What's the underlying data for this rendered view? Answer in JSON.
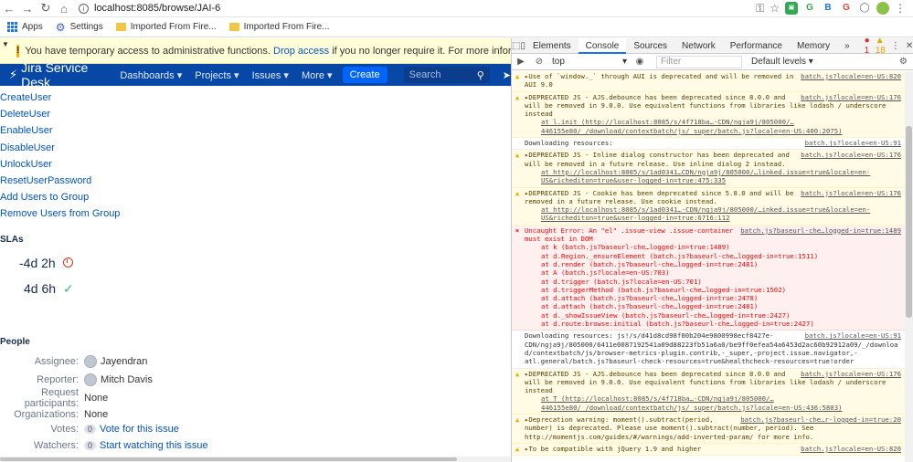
{
  "browser": {
    "url": "localhost:8085/browse/JAI-6",
    "bookmarks": [
      {
        "label": "Apps"
      },
      {
        "label": "Settings"
      },
      {
        "label": "Imported From Fire..."
      },
      {
        "label": "Imported From Fire..."
      }
    ],
    "extensions": [
      "G",
      "B",
      "G"
    ]
  },
  "banner": {
    "text_before": "You have temporary access to administrative functions.",
    "link": "Drop access",
    "text_after": "if you no longer require it. For more information, refer to the docs"
  },
  "jira_nav": {
    "logo": "Jira Service Desk",
    "items": [
      "Dashboards ▾",
      "Projects ▾",
      "Issues ▾",
      "More ▾"
    ],
    "create": "Create",
    "search_placeholder": "Search"
  },
  "links": [
    "CreateUser",
    "DeleteUser",
    "EnableUser",
    "DisableUser",
    "UnlockUser",
    "ResetUserPassword",
    "Add Users to Group",
    "Remove Users from Group"
  ],
  "slas": {
    "heading": "SLAs",
    "items": [
      "-4d 2h",
      "4d 6h"
    ]
  },
  "people": {
    "heading": "People",
    "assignee_label": "Assignee:",
    "assignee": "Jayendran",
    "reporter_label": "Reporter:",
    "reporter": "Mitch Davis",
    "participants_label": "Request participants:",
    "participants": "None",
    "organizations_label": "Organizations:",
    "organizations": "None",
    "votes_label": "Votes:",
    "votes_count": "0",
    "votes_link": "Vote for this issue",
    "watchers_label": "Watchers:",
    "watchers_count": "0",
    "watchers_link": "Start watching this issue"
  },
  "devtools": {
    "tabs": [
      "Elements",
      "Console",
      "Sources",
      "Network",
      "Performance",
      "Memory"
    ],
    "more": "»",
    "error_count": "1",
    "warning_count": "18",
    "context": "top",
    "filter_placeholder": "Filter",
    "levels": "Default levels ▾"
  },
  "console": [
    {
      "type": "warn",
      "text": "▸Use of `window._` through AUI is deprecated and will be removed in AUI 9.0",
      "src": "batch.js?locale=en-US:820"
    },
    {
      "type": "warn",
      "text": "▸DEPRECATED JS - AJS.debounce has been deprecated since 8.0.0 and will be removed in 9.0.0. Use equivalent functions from libraries like lodash / underscore instead",
      "src": "batch.js?locale=en-US:176",
      "trace": "at l.init (http://localhost:8085/s/4f718ba…-CDN/ngja9j/805000/…446155e80/_/download/contextbatch/js/_super/batch.js?locale=en-US:400:2075)"
    },
    {
      "type": "log",
      "text": "Downloading resources:",
      "src": "batch.js?locale=en-US:91"
    },
    {
      "type": "warn",
      "text": "▸DEPRECATED JS - Inline dialog constructor has been deprecated and will be removed in a future release. Use inline dialog 2 instead.",
      "src": "batch.js?locale=en-US:176",
      "trace": "at http://localhost:8085/s/1ad0341…CDN/ngja9j/805000/…linked.issue=true&locale=en-US&richediton=true&user-logged-in=true:475:335"
    },
    {
      "type": "warn",
      "text": "▸DEPRECATED JS - Cookie has been deprecated since 5.8.0 and will be removed in a future release. Use cookie instead.",
      "src": "batch.js?locale=en-US:176",
      "trace": "at http://localhost:8085/s/1ad0341…-CDN/ngja9j/805000/…inked.issue=true&locale=en-US&richediton=true&user-logged-in=true:6716:112"
    },
    {
      "type": "err",
      "text": "Uncaught Error: An \"el\" .issue-view .issue-container must exist in DOM",
      "src": "batch.js?baseurl-che…logged-in=true:1489",
      "stack": [
        "at k (batch.js?baseurl-che…logged-in=true:1489)",
        "at d.Region._ensureElement (batch.js?baseurl-che…logged-in=true:1511)",
        "at d.render (batch.js?baseurl-che…logged-in=true:2481)",
        "at A (batch.js?locale=en-US:703)",
        "at d.trigger (batch.js?locale=en-US:701)",
        "at d.triggerMethod (batch.js?baseurl-che…logged-in=true:1502)",
        "at d.attach (batch.js?baseurl-che…logged-in=true:2478)",
        "at d.attach (batch.js?baseurl-che…logged-in=true:2481)",
        "at d._showIssueView (batch.js?baseurl-che…logged-in=true:2427)",
        "at d.route:browse:initial (batch.js?baseurl-che…logged-in=true:2427)"
      ]
    },
    {
      "type": "log",
      "text": "Downloading resources: js!/s/d41d8cd98f00b204e9800998ecf8427e-CDN/ngja9j/805000/6411e0087192541a09d88223fb51a6a0/be9ff0efea54a6453d2ac60b92912a09/_/download/contextbatch/js/browser-metrics-plugin.contrib,-_super,-project.issue.navigator,-atl.general/batch.js?baseurl-check-resources=true&healthcheck-resources=true!order",
      "src": "batch.js?locale=en-US:91"
    },
    {
      "type": "warn",
      "text": "▸DEPRECATED JS - AJS.debounce has been deprecated since 8.0.0 and will be removed in 9.0.0. Use equivalent functions from libraries like lodash / underscore instead",
      "src": "batch.js?locale=en-US:176",
      "trace": "at T (http://localhost:8085/s/4f718ba…-CDN/ngja9j/805000/…446155e80/_/download/contextbatch/js/_super/batch.js?locale=en-US:436:5803)"
    },
    {
      "type": "warn",
      "text": "▸Deprecation warning: moment().subtract(period, number) is deprecated. Please use moment().subtract(number, period). See http://momentjs.com/guides/#/warnings/add-inverted-param/ for more info.",
      "src": "batch.js?baseurl-che…r-logged-in=true:20"
    },
    {
      "type": "warn",
      "text": "▸To be compatible with jQuery 1.9 and higher",
      "src": "batch.js?locale=en-US:820"
    }
  ]
}
